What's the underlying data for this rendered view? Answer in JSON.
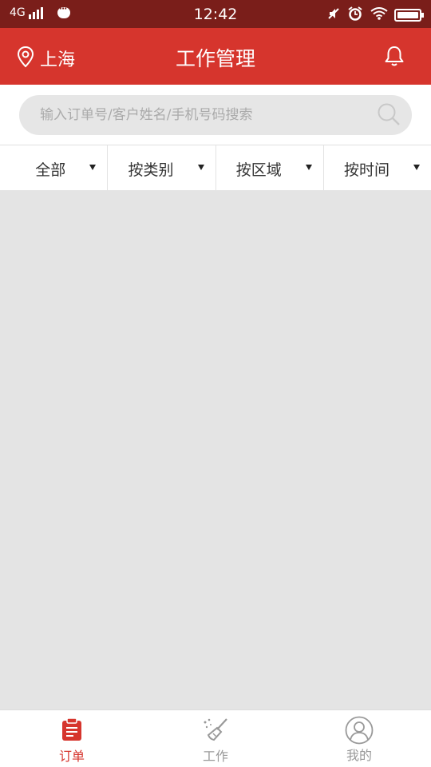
{
  "status_bar": {
    "network": "4G",
    "time": "12:42"
  },
  "header": {
    "location": "上海",
    "title": "工作管理"
  },
  "search": {
    "placeholder": "输入订单号/客户姓名/手机号码搜索"
  },
  "filters": [
    {
      "label": "全部"
    },
    {
      "label": "按类别"
    },
    {
      "label": "按区域"
    },
    {
      "label": "按时间"
    }
  ],
  "tabs": [
    {
      "label": "订单",
      "icon": "clipboard-icon",
      "active": true
    },
    {
      "label": "工作",
      "icon": "broom-icon",
      "active": false
    },
    {
      "label": "我的",
      "icon": "user-icon",
      "active": false
    }
  ],
  "colors": {
    "brand": "#d6352d",
    "status_bar": "#7a1e1a",
    "inactive_tab": "#999999"
  }
}
